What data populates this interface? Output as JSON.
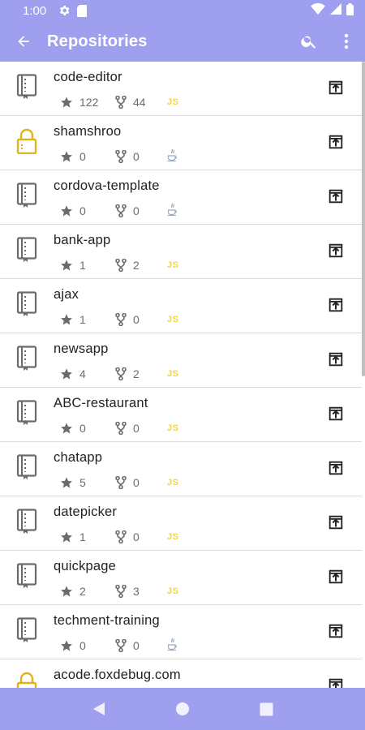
{
  "status_bar": {
    "time": "1:00"
  },
  "app_bar": {
    "title": "Repositories"
  },
  "repos": [
    {
      "name": "code-editor",
      "stars": "122",
      "forks": "44",
      "language": "JS",
      "private": false
    },
    {
      "name": "shamshroo",
      "stars": "0",
      "forks": "0",
      "language": "java",
      "private": true
    },
    {
      "name": "cordova-template",
      "stars": "0",
      "forks": "0",
      "language": "java",
      "private": false
    },
    {
      "name": "bank-app",
      "stars": "1",
      "forks": "2",
      "language": "JS",
      "private": false
    },
    {
      "name": "ajax",
      "stars": "1",
      "forks": "0",
      "language": "JS",
      "private": false
    },
    {
      "name": "newsapp",
      "stars": "4",
      "forks": "2",
      "language": "JS",
      "private": false
    },
    {
      "name": "ABC-restaurant",
      "stars": "0",
      "forks": "0",
      "language": "JS",
      "private": false
    },
    {
      "name": "chatapp",
      "stars": "5",
      "forks": "0",
      "language": "JS",
      "private": false
    },
    {
      "name": "datepicker",
      "stars": "1",
      "forks": "0",
      "language": "JS",
      "private": false
    },
    {
      "name": "quickpage",
      "stars": "2",
      "forks": "3",
      "language": "JS",
      "private": false
    },
    {
      "name": "techment-training",
      "stars": "0",
      "forks": "0",
      "language": "java",
      "private": false
    },
    {
      "name": "acode.foxdebug.com",
      "stars": "",
      "forks": "",
      "language": "",
      "private": true
    }
  ],
  "colors": {
    "primary": "#9f9ff0",
    "lock": "#e2b21b",
    "js": "#f0d44a",
    "icon_gray": "#6b6b6b"
  }
}
